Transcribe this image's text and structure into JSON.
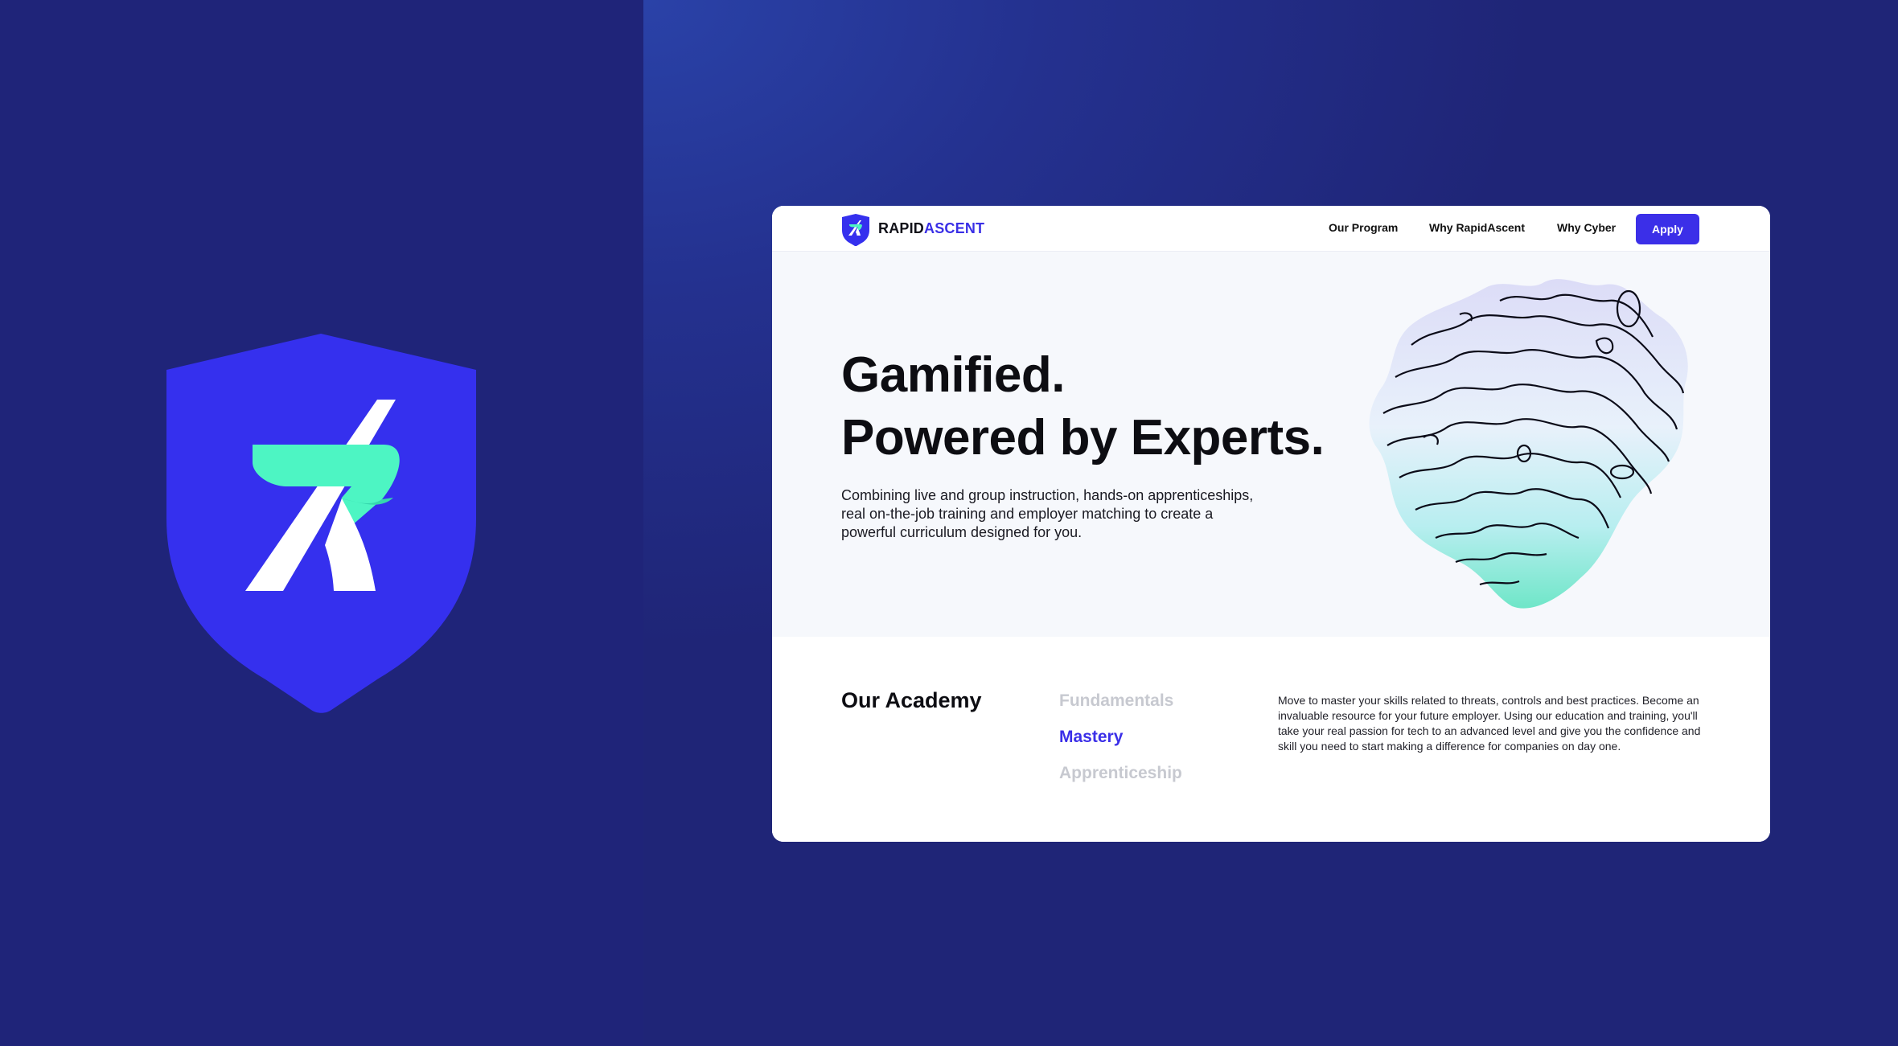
{
  "brand": {
    "name_primary": "RAPID",
    "name_accent": "ASCENT",
    "colors": {
      "primary": "#3b2fe8",
      "mint": "#4df5c3",
      "navy": "#1f2479"
    }
  },
  "nav": {
    "links": [
      "Our Program",
      "Why RapidAscent",
      "Why Cyber"
    ],
    "apply_label": "Apply"
  },
  "hero": {
    "headline_line1": "Gamified.",
    "headline_line2": "Powered by Experts.",
    "subtext": "Combining live and group instruction, hands-on apprenticeships, real on-the-job training and employer matching to create a powerful curriculum designed for you."
  },
  "academy": {
    "title": "Our Academy",
    "tabs": [
      {
        "label": "Fundamentals",
        "active": false
      },
      {
        "label": "Mastery",
        "active": true
      },
      {
        "label": "Apprenticeship",
        "active": false
      }
    ],
    "description": "Move to master your skills related to threats, controls and best practices. Become an invaluable resource for your future employer. Using our education and training, you'll take your real passion for tech to an advanced level and give you the confidence and skill you need to start making a difference for companies on day one."
  },
  "icons": [
    "rapidascent-shield-logo-icon",
    "rapidascent-small-logo-icon",
    "topographic-blob-illustration"
  ]
}
